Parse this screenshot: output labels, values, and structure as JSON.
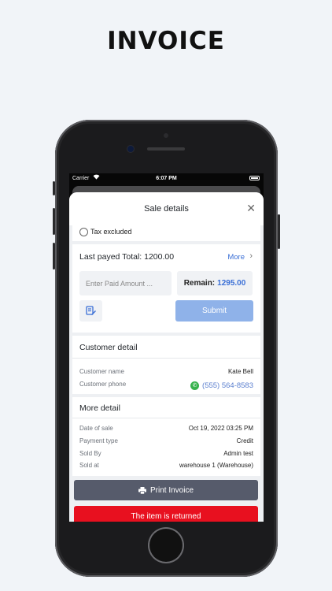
{
  "headline": "INVOICE",
  "status_bar": {
    "carrier": "Carrier",
    "time": "6:07 PM"
  },
  "sheet": {
    "title": "Sale details",
    "close_icon": "close-icon",
    "tax": {
      "label": "Tax excluded",
      "checked": false
    },
    "payment": {
      "last_payed": "Last payed Total: 1200.00",
      "more_label": "More",
      "amount_placeholder": "Enter Paid Amount ...",
      "amount_value": "",
      "remain_label": "Remain:",
      "remain_value": "1295.00",
      "submit_label": "Submit"
    },
    "customer": {
      "title": "Customer detail",
      "name_label": "Customer name",
      "name_value": "Kate Bell",
      "phone_label": "Customer phone",
      "phone_value": "(555) 564-8583"
    },
    "more_detail": {
      "title": "More detail",
      "rows": [
        {
          "label": "Date of sale",
          "value": "Oct 19, 2022 03:25 PM"
        },
        {
          "label": "Payment type",
          "value": "Credit"
        },
        {
          "label": "Sold By",
          "value": "Admin test"
        },
        {
          "label": "Sold at",
          "value": "warehouse 1 (Warehouse)"
        }
      ]
    },
    "print_label": "Print Invoice",
    "returned_label": "The item is returned"
  },
  "colors": {
    "accent": "#3a6fd6",
    "submit": "#8fb2e9",
    "print": "#565b6b",
    "returned": "#e8101f",
    "whatsapp": "#37b24d"
  }
}
